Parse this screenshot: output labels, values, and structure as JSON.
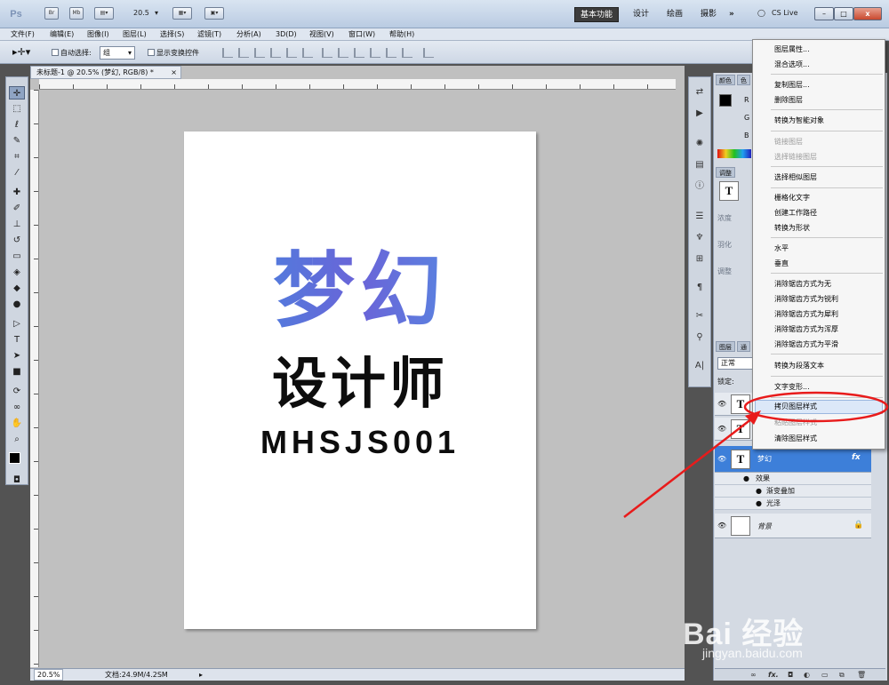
{
  "titlebar": {
    "logo": "Ps",
    "icon_br": "Br",
    "icon_mb": "Mb",
    "zoom": "20.5",
    "workspaces": [
      "基本功能",
      "设计",
      "绘画",
      "摄影"
    ],
    "more": "»",
    "cslive": "CS Live",
    "win_min": "–",
    "win_max": "□",
    "win_close": "x"
  },
  "menubar": {
    "items": [
      "文件(F)",
      "编辑(E)",
      "图像(I)",
      "图层(L)",
      "选择(S)",
      "滤镜(T)",
      "分析(A)",
      "3D(D)",
      "视图(V)",
      "窗口(W)",
      "帮助(H)"
    ]
  },
  "options": {
    "auto_select_label": "自动选择:",
    "auto_select_value": "组",
    "show_transform_label": "显示变换控件"
  },
  "document": {
    "tab_title": "未标题-1 @ 20.5% (梦幻, RGB/8) *",
    "tab_close": "×",
    "zoom_status": "20.5%",
    "doc_size": "文档:24.9M/4.2SM",
    "canvas_title": "梦幻",
    "canvas_subtitle": "设计师",
    "canvas_code": "MHSJS001"
  },
  "panels": {
    "color_tab": "颜色",
    "color_tab2": "色",
    "color_labels": [
      "R",
      "G",
      "B"
    ],
    "adjust_tab": "调整",
    "layers_tab": "图层",
    "layers_tab2": "通",
    "blend_mode": "正常",
    "lock_label": "锁定:",
    "layers": [
      {
        "name": "",
        "thumb": "T"
      },
      {
        "name": "",
        "thumb": "T"
      },
      {
        "name": "梦幻",
        "thumb": "T",
        "fx": "fx"
      },
      {
        "name": "背景",
        "thumb": ""
      }
    ],
    "effects_label": "效果",
    "effect_gradient": "渐变叠加",
    "effect_gloss": "光泽",
    "sidebar_labels": [
      "浓度",
      "羽化",
      "调整"
    ]
  },
  "context_menu": {
    "items": [
      {
        "label": "图层属性...",
        "enabled": true
      },
      {
        "label": "混合选项...",
        "enabled": true
      },
      {
        "label": "复制图层...",
        "enabled": true
      },
      {
        "label": "删除图层",
        "enabled": true
      },
      {
        "label": "转换为智能对象",
        "enabled": true
      },
      {
        "label": "链接图层",
        "enabled": false
      },
      {
        "label": "选择链接图层",
        "enabled": false
      },
      {
        "label": "选择相似图层",
        "enabled": true
      },
      {
        "label": "栅格化文字",
        "enabled": true
      },
      {
        "label": "创建工作路径",
        "enabled": true
      },
      {
        "label": "转换为形状",
        "enabled": true
      },
      {
        "label": "水平",
        "enabled": true
      },
      {
        "label": "垂直",
        "enabled": true
      },
      {
        "label": "消除锯齿方式为无",
        "enabled": true
      },
      {
        "label": "消除锯齿方式为锐利",
        "enabled": true
      },
      {
        "label": "消除锯齿方式为犀利",
        "enabled": true
      },
      {
        "label": "消除锯齿方式为浑厚",
        "enabled": true
      },
      {
        "label": "消除锯齿方式为平滑",
        "enabled": true
      },
      {
        "label": "转换为段落文本",
        "enabled": true
      },
      {
        "label": "文字变形...",
        "enabled": true
      },
      {
        "label": "拷贝图层样式",
        "enabled": true
      },
      {
        "label": "粘贴图层样式",
        "enabled": false
      },
      {
        "label": "清除图层样式",
        "enabled": true
      }
    ]
  },
  "watermark": {
    "logo": "Bai 经验",
    "url": "jingyan.baidu.com"
  },
  "colors": {
    "annotation": "#e81b1b",
    "selection": "#3d7fd9",
    "canvas_gradient_start": "#3d8fe0",
    "canvas_gradient_end": "#6a64d8"
  },
  "icons": {
    "move_tool": "move-tool-icon",
    "marquee_tool": "marquee-tool-icon",
    "lasso_tool": "lasso-tool-icon"
  }
}
